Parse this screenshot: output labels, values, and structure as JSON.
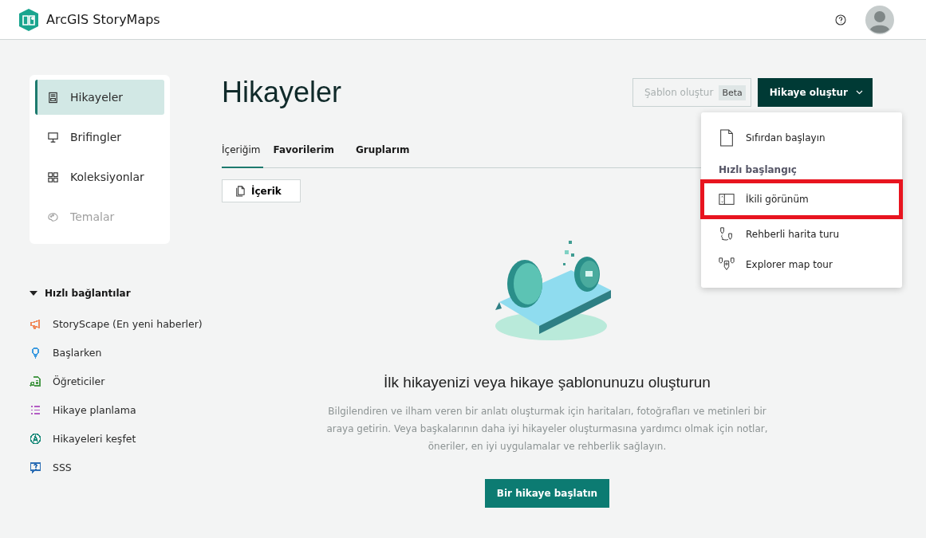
{
  "header": {
    "app_name": "ArcGIS StoryMaps"
  },
  "sidebar": {
    "items": [
      {
        "label": "Hikayeler",
        "selected": true,
        "disabled": false
      },
      {
        "label": "Brifingler",
        "selected": false,
        "disabled": false
      },
      {
        "label": "Koleksiyonlar",
        "selected": false,
        "disabled": false
      },
      {
        "label": "Temalar",
        "selected": false,
        "disabled": true
      }
    ]
  },
  "quick_links": {
    "title": "Hızlı bağlantılar",
    "expanded": true,
    "items": [
      {
        "label": "StoryScape (En yeni haberler)",
        "color": "#f0885a"
      },
      {
        "label": "Başlarken",
        "color": "#3d9be0"
      },
      {
        "label": "Öğreticiler",
        "color": "#4a9a4a"
      },
      {
        "label": "Hikaye planlama",
        "color": "#b35cc4"
      },
      {
        "label": "Hikayeleri keşfet",
        "color": "#1a8a7a"
      },
      {
        "label": "SSS",
        "color": "#2e6fb5"
      }
    ]
  },
  "page": {
    "title": "Hikayeler",
    "template_button": {
      "label": "Şablon oluştur",
      "badge": "Beta",
      "disabled": true
    },
    "create_button": {
      "label": "Hikaye oluştur"
    },
    "tabs": [
      {
        "label": "İçeriğim",
        "selected": true
      },
      {
        "label": "Favorilerim",
        "selected": false
      },
      {
        "label": "Gruplarım",
        "selected": false
      }
    ],
    "filter": {
      "label": "İçerik"
    },
    "empty_state": {
      "heading": "İlk hikayenizi veya hikaye şablonunuzu oluşturun",
      "text": "Bilgilendiren ve ilham veren bir anlatı oluşturmak için haritaları, fotoğrafları ve metinleri bir araya getirin. Veya başkalarının daha iyi hikayeler oluşturmasına yardımcı olmak için notlar, öneriler, en iyi uygulamalar ve rehberlik sağlayın.",
      "button": "Bir hikaye başlatın"
    }
  },
  "create_menu": {
    "items": [
      {
        "kind": "item",
        "label": "Sıfırdan başlayın",
        "highlighted": false
      },
      {
        "kind": "header",
        "label": "Hızlı başlangıç"
      },
      {
        "kind": "item",
        "label": "İkili görünüm",
        "highlighted": true
      },
      {
        "kind": "item",
        "label": "Rehberli harita turu",
        "highlighted": false
      },
      {
        "kind": "item",
        "label": "Explorer map tour",
        "highlighted": false
      }
    ]
  }
}
